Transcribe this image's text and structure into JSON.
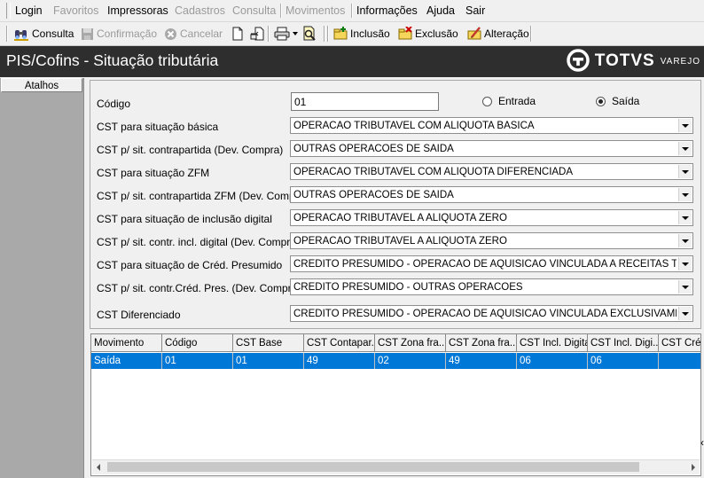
{
  "menu": [
    {
      "label": "Login",
      "disabled": false
    },
    {
      "label": "Favoritos",
      "disabled": true
    },
    {
      "label": "Impressoras",
      "disabled": false
    },
    {
      "label": "Cadastros",
      "disabled": true
    },
    {
      "label": "Consulta",
      "disabled": true
    },
    {
      "label": "Movimentos",
      "disabled": true
    },
    {
      "label": "Informações",
      "disabled": false
    },
    {
      "label": "Ajuda",
      "disabled": false
    },
    {
      "label": "Sair",
      "disabled": false
    }
  ],
  "toolbar": {
    "consulta": "Consulta",
    "confirmacao": "Confirmação",
    "cancelar": "Cancelar",
    "inclusao": "Inclusão",
    "exclusao": "Exclusão",
    "alteracao": "Alteração"
  },
  "window": {
    "title": "PIS/Cofins - Situação tributária",
    "brand": "TOTVS",
    "brand_sub": "VAREJO"
  },
  "sidebar": {
    "header": "Atalhos"
  },
  "form": {
    "codigo_label": "Código",
    "codigo_value": "01",
    "radio_entrada": "Entrada",
    "radio_saida": "Saída",
    "selected_radio": "saida",
    "fields": [
      {
        "label": "CST para situação básica",
        "value": "OPERACAO TRIBUTAVEL COM ALIQUOTA BASICA"
      },
      {
        "label": "CST p/ sit. contrapartida (Dev. Compra)",
        "value": "OUTRAS OPERACOES DE SAIDA"
      },
      {
        "label": "CST para situação ZFM",
        "value": "OPERACAO TRIBUTAVEL COM ALIQUOTA DIFERENCIADA"
      },
      {
        "label": "CST p/ sit. contrapartida ZFM (Dev. Compra)",
        "value": "OUTRAS OPERACOES DE SAIDA"
      },
      {
        "label": "CST para situação de inclusão digital",
        "value": "OPERACAO TRIBUTAVEL A ALIQUOTA ZERO"
      },
      {
        "label": "CST p/ sit. contr. incl. digital (Dev. Compra)",
        "value": "OPERACAO TRIBUTAVEL A ALIQUOTA ZERO"
      },
      {
        "label": "CST para situação de Créd. Presumido",
        "value": "CREDITO PRESUMIDO - OPERACAO DE AQUISICAO VINCULADA A RECEITAS TRIBUT"
      },
      {
        "label": "CST p/ sit. contr.Créd. Pres. (Dev. Compra)",
        "value": "CREDITO PRESUMIDO - OUTRAS OPERACOES"
      },
      {
        "label": "CST Diferenciado",
        "value": "CREDITO PRESUMIDO - OPERACAO DE AQUISICAO VINCULADA EXCLUSIVAMENTE A"
      }
    ]
  },
  "grid": {
    "columns": [
      "Movimento",
      "Código",
      "CST Base",
      "CST Contapar...",
      "CST Zona fra...",
      "CST Zona fra...",
      "CST Incl. Digital",
      "CST Incl. Digi...",
      "CST Créd"
    ],
    "rows": [
      [
        "Saída",
        "01",
        "01",
        "49",
        "02",
        "49",
        "06",
        "06",
        ""
      ]
    ]
  },
  "colors": {
    "selection": "#0078d7",
    "titlebar": "#2e2e2e",
    "sidebar": "#a9a9a9"
  }
}
